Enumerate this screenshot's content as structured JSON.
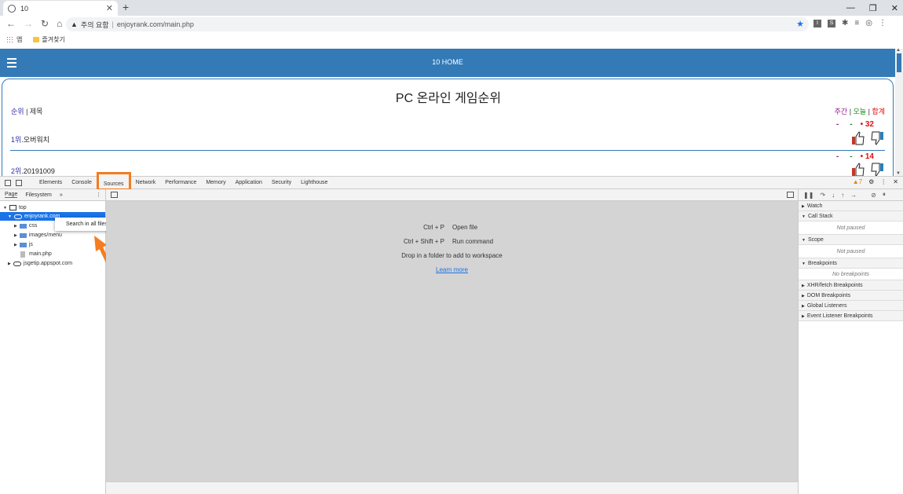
{
  "browser": {
    "tab_title": "10",
    "close_glyph": "✕",
    "new_tab_glyph": "+",
    "security_label": "주의 요함",
    "url": "enjoyrank.com/main.php",
    "bookmarks": [
      "앱",
      "즐겨찾기"
    ],
    "ext_icons": [
      "I",
      "S"
    ]
  },
  "site": {
    "header_title": "10 HOME",
    "rank_title": "PC 온라인 게임순위",
    "col_rank": "순위",
    "col_sep": " | ",
    "col_title": "제목",
    "period_week": "주간",
    "period_today": "오늘",
    "period_total": "합계",
    "items": [
      {
        "rank": "1위",
        "name": ".오버워치",
        "dash1": "-",
        "dash2": "-",
        "score": "32"
      },
      {
        "rank": "2위",
        "name": ".20191009",
        "dash1": "-",
        "dash2": "-",
        "score": "14"
      }
    ]
  },
  "devtools": {
    "tabs": [
      "Elements",
      "Console",
      "Sources",
      "Network",
      "Performance",
      "Memory",
      "Application",
      "Security",
      "Lighthouse"
    ],
    "active_tab": "Sources",
    "warning_count": "7",
    "sub_tabs": [
      "Page",
      "Filesystem"
    ],
    "tree": {
      "top": "top",
      "domain": "enjoyrank.com",
      "folders": [
        "css",
        "images/menu",
        "js"
      ],
      "file": "main.php",
      "other_domain": "jsgetip.appspot.com"
    },
    "context_menu_item": "Search in all files",
    "shortcuts": [
      {
        "keys": "Ctrl + P",
        "action": "Open file"
      },
      {
        "keys": "Ctrl + Shift + P",
        "action": "Run command"
      }
    ],
    "drop_text": "Drop in a folder to add to workspace",
    "learn_more": "Learn more",
    "right_panel": {
      "watch": "Watch",
      "call_stack": "Call Stack",
      "not_paused_1": "Not paused",
      "scope": "Scope",
      "not_paused_2": "Not paused",
      "breakpoints": "Breakpoints",
      "no_breakpoints": "No breakpoints",
      "xhr": "XHR/fetch Breakpoints",
      "dom": "DOM Breakpoints",
      "global": "Global Listeners",
      "event": "Event Listener Breakpoints"
    }
  },
  "colors": {
    "accent": "#337ab7",
    "highlight": "#f57c20",
    "selection": "#1a73e8"
  }
}
